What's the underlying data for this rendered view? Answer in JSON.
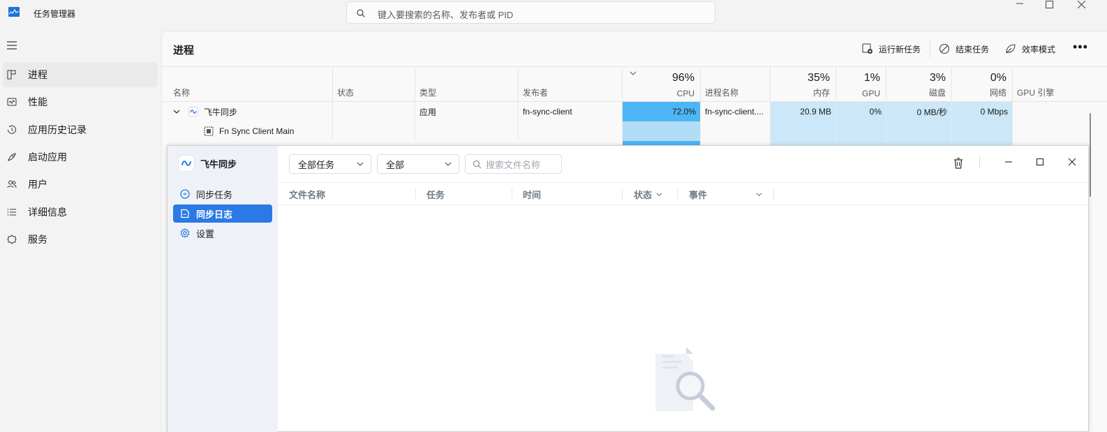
{
  "titlebar": {
    "title": "任务管理器",
    "search_placeholder": "键入要搜索的名称、发布者或 PID"
  },
  "nav": {
    "items": [
      {
        "label": "进程",
        "icon": "processes-icon",
        "active": true
      },
      {
        "label": "性能",
        "icon": "performance-icon"
      },
      {
        "label": "应用历史记录",
        "icon": "app-history-icon"
      },
      {
        "label": "启动应用",
        "icon": "startup-icon"
      },
      {
        "label": "用户",
        "icon": "users-icon"
      },
      {
        "label": "详细信息",
        "icon": "details-icon"
      },
      {
        "label": "服务",
        "icon": "services-icon"
      }
    ]
  },
  "main": {
    "title": "进程",
    "commands": {
      "run_new_task": "运行新任务",
      "end_task": "结束任务",
      "efficiency_mode": "效率模式"
    }
  },
  "table": {
    "headers": {
      "name": "名称",
      "status": "状态",
      "type": "类型",
      "publisher": "发布者",
      "cpu_pct": "96%",
      "cpu": "CPU",
      "process_name": "进程名称",
      "memory_pct": "35%",
      "memory": "内存",
      "gpu_pct": "1%",
      "gpu": "GPU",
      "disk_pct": "3%",
      "disk": "磁盘",
      "network_pct": "0%",
      "network": "网络",
      "gpu_engine": "GPU 引擎"
    },
    "rows": [
      {
        "name": "飞牛同步",
        "type": "应用",
        "publisher": "fn-sync-client",
        "cpu": "72.0%",
        "process_name": "fn-sync-client....",
        "memory": "20.9 MB",
        "gpu": "0%",
        "disk": "0 MB/秒",
        "network": "0 Mbps"
      },
      {
        "name": "Fn Sync Client Main"
      }
    ]
  },
  "fn_window": {
    "brand": "飞牛同步",
    "nav": [
      {
        "label": "同步任务"
      },
      {
        "label": "同步日志",
        "active": true
      },
      {
        "label": "设置"
      }
    ],
    "filter_task": "全部任务",
    "filter_all": "全部",
    "search_placeholder": "搜索文件名称",
    "columns": {
      "filename": "文件名称",
      "task": "任务",
      "time": "时间",
      "status": "状态",
      "event": "事件"
    }
  },
  "colors": {
    "accent": "#2a79e4",
    "cpu_heat": "#4db5f4",
    "heat": "#cce7f7"
  }
}
